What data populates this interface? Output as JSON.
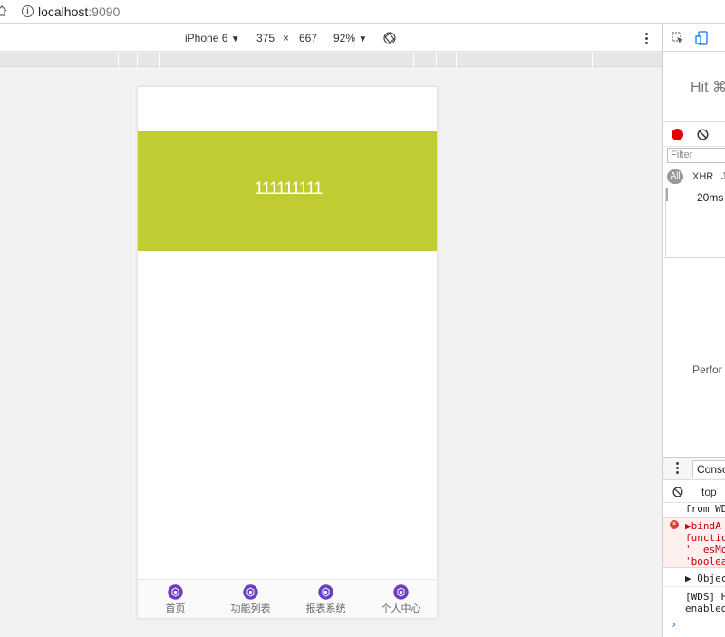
{
  "browser": {
    "url_host": "localhost",
    "url_port": ":9090"
  },
  "device_toolbar": {
    "device": "iPhone 6",
    "device_arrow": "▼",
    "width": "375",
    "times": "×",
    "height": "667",
    "zoom": "92%",
    "zoom_arrow": "▼"
  },
  "app": {
    "banner_text": "111111111",
    "banner_color": "#c1cc33",
    "tab_icon_color": "#6a3fc0",
    "tabs": [
      {
        "label": "首页"
      },
      {
        "label": "功能列表"
      },
      {
        "label": "报表系统"
      },
      {
        "label": "个人中心"
      }
    ]
  },
  "devtools": {
    "hint": "Hit ⌘",
    "record_color": "#e00000",
    "filter_placeholder": "Filter",
    "type_all": "All",
    "type_xhr": "XHR",
    "type_j": "J",
    "timing": "20ms",
    "perf": "Perfor",
    "console_tab": "Conso",
    "context": "top",
    "console_lines": [
      {
        "text": "from WD"
      },
      {
        "text": "▶bindA"
      },
      {
        "text": "functic"
      },
      {
        "text": "'__esMo"
      },
      {
        "text": "'boolea"
      },
      {
        "text": "▶ Objec"
      },
      {
        "text": "[WDS] H"
      },
      {
        "text": "enabled"
      }
    ],
    "prompt": "›"
  }
}
